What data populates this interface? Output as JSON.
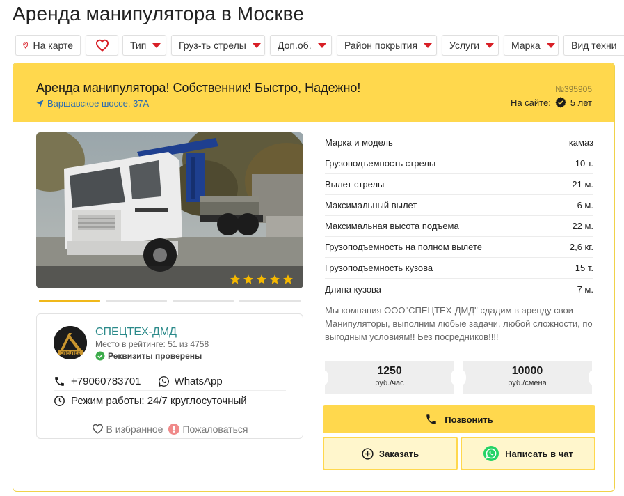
{
  "page": {
    "title": "Аренда манипулятора в Москве"
  },
  "filters": [
    {
      "label": "На карте",
      "icon": "map-pin-icon"
    },
    {
      "label": "",
      "icon": "heart-icon"
    },
    {
      "label": "Тип",
      "icon": "dropdown-arrow-icon"
    },
    {
      "label": "Груз-ть стрелы",
      "icon": "dropdown-arrow-icon"
    },
    {
      "label": "Доп.об.",
      "icon": "dropdown-arrow-icon"
    },
    {
      "label": "Район покрытия",
      "icon": "dropdown-arrow-icon"
    },
    {
      "label": "Услуги",
      "icon": "dropdown-arrow-icon"
    },
    {
      "label": "Марка",
      "icon": "dropdown-arrow-icon"
    },
    {
      "label": "Вид техни",
      "icon": ""
    }
  ],
  "listing": {
    "title": "Аренда манипулятора! Собственник! Быстро, Надежно!",
    "address": "Варшавское шоссе, 37А",
    "id": "№395905",
    "on_site_label": "На сайте:",
    "on_site_value": "5 лет",
    "rating_stars": 5,
    "photo_count": 4,
    "active_photo": 1
  },
  "owner": {
    "name": "СПЕЦТЕХ-ДМД",
    "logo_text": "СПЕЦТЕХ",
    "rating": "Место в рейтинге: 51 из 4758",
    "verified": "Реквизиты проверены",
    "phone": "+79060783701",
    "messenger": "WhatsApp",
    "hours": "Режим работы: 24/7 круглосуточный",
    "favorite": "В избранное",
    "report": "Пожаловаться"
  },
  "specs": [
    {
      "label": "Марка и модель",
      "value": "камаз"
    },
    {
      "label": "Грузоподъемность стрелы",
      "value": "10 т."
    },
    {
      "label": "Вылет стрелы",
      "value": "21 м."
    },
    {
      "label": "Максимальный вылет",
      "value": "6 м."
    },
    {
      "label": "Максимальная высота подъема",
      "value": "22 м."
    },
    {
      "label": "Грузоподъемность на полном вылете",
      "value": "2,6 кг."
    },
    {
      "label": "Грузоподъемность кузова",
      "value": "15 т."
    },
    {
      "label": "Длина кузова",
      "value": "7 м."
    }
  ],
  "description": "Мы компания ООО\"СПЕЦТЕХ-ДМД\" сдадим в аренду свои Манипуляторы, выполним любые задачи, любой сложности, по выгодным условиям!! Без посредников!!!!",
  "prices": [
    {
      "value": "1250",
      "unit": "руб./час"
    },
    {
      "value": "10000",
      "unit": "руб./смена"
    }
  ],
  "actions": {
    "call": "Позвонить",
    "order": "Заказать",
    "chat": "Написать в чат"
  },
  "colors": {
    "accent_yellow": "#ffd84d",
    "accent_red": "#d81f26",
    "link_blue": "#2b6cb0",
    "company_teal": "#2b8a8a",
    "whatsapp_green": "#25d366",
    "star_gold": "#f5b800"
  }
}
